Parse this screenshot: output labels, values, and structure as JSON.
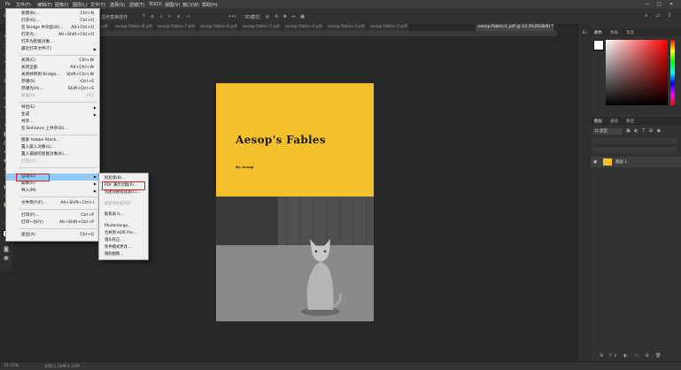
{
  "menubar": {
    "items": [
      "文件(F)",
      "编辑(E)",
      "图像(I)",
      "图层(L)",
      "文字(Y)",
      "选择(S)",
      "滤镜(T)",
      "3D(D)",
      "视图(V)",
      "窗口(W)",
      "帮助(H)"
    ]
  },
  "optionbar": {
    "text": "显示变换控件",
    "mode_label": "3D模式:"
  },
  "tabs": [
    "...pdf",
    "aesop-fables-8.pdf",
    "aesop-fables-7.pdf",
    "aesop-fables-6.pdf",
    "aesop-fables-5.pdf",
    "aesop-fables-4.pdf",
    "aesop-fables-3.pdf",
    "aesop-fables-2.pdf",
    "aesop-fables-1.pdf @ 33.3%(RGB/8) *"
  ],
  "document": {
    "title": "Aesop's Fables",
    "author": "By Aesop"
  },
  "file_menu": [
    {
      "label": "新建(N)...",
      "shortcut": "Ctrl+N"
    },
    {
      "label": "打开(O)...",
      "shortcut": "Ctrl+O"
    },
    {
      "label": "在 Bridge 中浏览(B)...",
      "shortcut": "Alt+Ctrl+O"
    },
    {
      "label": "打开为...",
      "shortcut": "Alt+Shift+Ctrl+O"
    },
    {
      "label": "打开为智能对象...",
      "shortcut": ""
    },
    {
      "label": "最近打开文件(T)",
      "shortcut": ""
    },
    {
      "label": "关闭(C)",
      "shortcut": "Ctrl+W"
    },
    {
      "label": "关闭全部",
      "shortcut": "Alt+Ctrl+W"
    },
    {
      "label": "关闭并转到 Bridge...",
      "shortcut": "Shift+Ctrl+W"
    },
    {
      "label": "存储(S)",
      "shortcut": "Ctrl+S"
    },
    {
      "label": "存储为(A)...",
      "shortcut": "Shift+Ctrl+S"
    },
    {
      "label": "恢复(V)",
      "shortcut": "F12"
    },
    {
      "label": "导出(E)",
      "shortcut": ""
    },
    {
      "label": "生成",
      "shortcut": ""
    },
    {
      "label": "共享...",
      "shortcut": ""
    },
    {
      "label": "在 Behance 上共享(D)...",
      "shortcut": ""
    },
    {
      "label": "搜索 Adobe Stock...",
      "shortcut": ""
    },
    {
      "label": "置入嵌入对象(L)...",
      "shortcut": ""
    },
    {
      "label": "置入链接的智能对象(K)...",
      "shortcut": ""
    },
    {
      "label": "打包(G)...",
      "shortcut": ""
    },
    {
      "label": "自动(U)",
      "shortcut": ""
    },
    {
      "label": "脚本(R)",
      "shortcut": ""
    },
    {
      "label": "导入(M)",
      "shortcut": ""
    },
    {
      "label": "文件简介(F)...",
      "shortcut": "Alt+Shift+Ctrl+I"
    },
    {
      "label": "打印(P)...",
      "shortcut": "Ctrl+P"
    },
    {
      "label": "打印一份(Y)",
      "shortcut": "Alt+Shift+Ctrl+P"
    },
    {
      "label": "退出(X)",
      "shortcut": "Ctrl+Q"
    }
  ],
  "automate_submenu": [
    "批处理(B)...",
    "PDF 演示文稿(P)...",
    "创建快捷批处理(C)...",
    "裁剪并拉直照片",
    "联系表 II...",
    "Photomerge...",
    "合并到 HDR Pro...",
    "镜头校正...",
    "条件模式更改...",
    "限制图像..."
  ],
  "right_panel": {
    "tabs_top": [
      "颜色",
      "色板",
      "渐变"
    ],
    "tabs_layers": [
      "图层",
      "通道",
      "路径"
    ],
    "search_placeholder": "Q 类型",
    "layer_name": "图层 1"
  },
  "status": {
    "zoom": "33.33%",
    "doc": "文档:1.26M/1.26M"
  }
}
